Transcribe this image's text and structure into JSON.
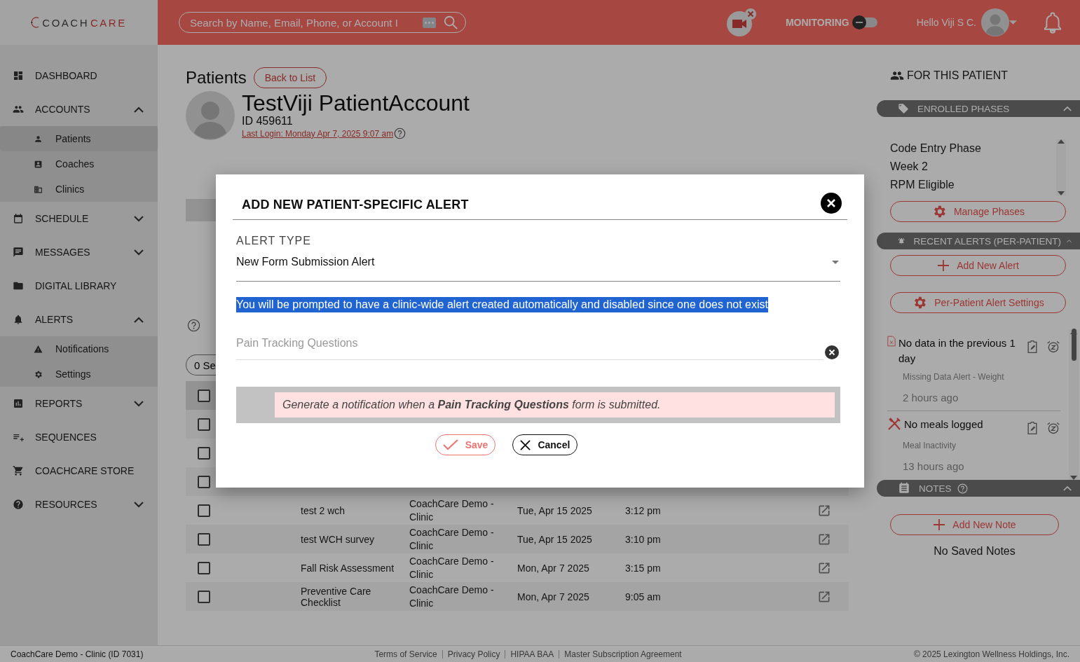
{
  "brand": {
    "prefix": "COACH",
    "suffix": "CARE"
  },
  "search": {
    "placeholder": "Search by Name, Email, Phone, or Account I"
  },
  "monitoring": {
    "label": "MONITORING",
    "on": false
  },
  "user": {
    "greeting": "Hello Viji S C."
  },
  "sidebar": {
    "items": [
      {
        "label": "DASHBOARD"
      },
      {
        "label": "ACCOUNTS",
        "expanded": true,
        "children": [
          {
            "label": "Patients",
            "selected": true
          },
          {
            "label": "Coaches",
            "selected": false
          },
          {
            "label": "Clinics",
            "selected": false
          }
        ]
      },
      {
        "label": "SCHEDULE",
        "expanded": false
      },
      {
        "label": "MESSAGES",
        "expanded": false
      },
      {
        "label": "DIGITAL LIBRARY"
      },
      {
        "label": "ALERTS",
        "expanded": true,
        "children": [
          {
            "label": "Notifications",
            "selected": false
          },
          {
            "label": "Settings",
            "selected": false
          }
        ]
      },
      {
        "label": "REPORTS",
        "expanded": false
      },
      {
        "label": "SEQUENCES"
      },
      {
        "label": "COACHCARE STORE"
      },
      {
        "label": "RESOURCES",
        "expanded": false
      }
    ]
  },
  "patient": {
    "section_title": "Patients",
    "back_button": "Back to List",
    "name": "TestViji PatientAccount",
    "id": "ID 459611",
    "last_login": "Last Login: Monday Apr 7, 2025 9:07 am"
  },
  "selection_button": "0 Se",
  "table": {
    "header_checked": false,
    "rows": [
      {
        "checked": false
      },
      {
        "checked": false
      },
      {
        "checked": false
      },
      {
        "checked": false,
        "name": "test 2 wch",
        "clinic": "CoachCare Demo - Clinic",
        "date": "Tue, Apr 15 2025",
        "time": "3:12 pm"
      },
      {
        "checked": false,
        "name": "test WCH survey",
        "clinic": "CoachCare Demo - Clinic",
        "date": "Tue, Apr 15 2025",
        "time": "3:10 pm"
      },
      {
        "checked": false,
        "name": "Fall Risk Assessment",
        "clinic": "CoachCare Demo - Clinic",
        "date": "Mon, Apr 7 2025",
        "time": "3:15 pm"
      },
      {
        "checked": false,
        "name": "Preventive Care Checklist",
        "clinic": "CoachCare Demo - Clinic",
        "date": "Mon, Apr 7 2025",
        "time": "9:05 am"
      }
    ]
  },
  "right_panel": {
    "title": "FOR THIS PATIENT",
    "phases": {
      "title": "ENROLLED PHASES",
      "expanded": true,
      "items": [
        "Code Entry Phase",
        "Week 2",
        "RPM Eligible"
      ],
      "button": "Manage Phases"
    },
    "alerts": {
      "title": "RECENT ALERTS (PER-PATIENT)",
      "expanded": true,
      "buttons": [
        "Add New Alert",
        "Per-Patient Alert Settings"
      ],
      "items": [
        {
          "kind": "missing",
          "title": "No data in the previous 1 day",
          "type": "Missing Data Alert - Weight",
          "time": "2 hours ago"
        },
        {
          "kind": "meal",
          "title": "No meals logged",
          "type": "Meal Inactivity",
          "time": "13 hours ago"
        }
      ]
    },
    "notes": {
      "title": "NOTES",
      "expanded": true,
      "button": "Add New Note",
      "empty": "No Saved Notes"
    }
  },
  "modal": {
    "title": "ADD NEW PATIENT-SPECIFIC ALERT",
    "alert_type_label": "ALERT TYPE",
    "alert_type_value": "New Form Submission Alert",
    "notice": {
      "text": "You will be prompted to have a clinic-wide alert created automatically and disabled since one does not exist",
      "highlighted": true
    },
    "form_field": {
      "placeholder": "Pain Tracking Questions"
    },
    "info": "Generate a notification when a **Pain Tracking Questions** form is submitted.",
    "save": "Save",
    "cancel": "Cancel"
  },
  "footer": {
    "clinic": "CoachCare Demo - Clinic (ID 7031)",
    "links": [
      "Terms of Service",
      "Privacy Policy",
      "HIPAA BAA",
      "Master Subscription Agreement"
    ],
    "copyright": "© 2025 Lexington Wellness Holdings, Inc."
  }
}
